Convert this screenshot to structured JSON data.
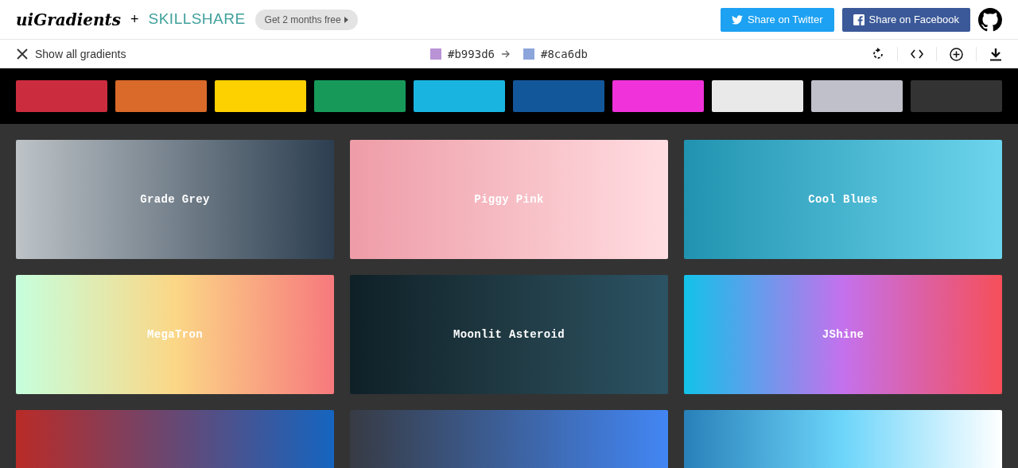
{
  "header": {
    "logo": "uiGradients",
    "plus": "+",
    "partner": "SKILLSHARE",
    "promo": "Get 2 months free",
    "buttons": [
      {
        "kind": "twitter",
        "label": "Share on Twitter"
      },
      {
        "kind": "facebook",
        "label": "Share on Facebook"
      }
    ]
  },
  "toolbar": {
    "back": "Show all gradients",
    "from": {
      "color": "#b993d6",
      "label": "#b993d6"
    },
    "to": {
      "color": "#8ca6db",
      "label": "#8ca6db"
    }
  },
  "swatches": [
    {
      "color": "#cb2d3e"
    },
    {
      "color": "#da6a29"
    },
    {
      "color": "#fdd000"
    },
    {
      "color": "#17995a"
    },
    {
      "color": "#1ab4e1"
    },
    {
      "color": "#13579b"
    },
    {
      "color": "#ef32d9"
    },
    {
      "color": "#e9e9e9"
    },
    {
      "color": "#bfc0c9"
    },
    {
      "color": "#333333"
    }
  ],
  "gradients": [
    {
      "name": "Grade Grey",
      "stops": [
        {
          "color": "#bdc3c7"
        },
        {
          "color": "#2c3e50"
        }
      ]
    },
    {
      "name": "Piggy Pink",
      "stops": [
        {
          "color": "#ee9ca7"
        },
        {
          "color": "#ffdde1"
        }
      ]
    },
    {
      "name": "Cool Blues",
      "stops": [
        {
          "color": "#2193b0"
        },
        {
          "color": "#6dd5ed"
        }
      ]
    },
    {
      "name": "MegaTron",
      "stops": [
        {
          "color": "#c6ffdd"
        },
        {
          "color": "#fbd786"
        },
        {
          "color": "#f7797d"
        }
      ]
    },
    {
      "name": "Moonlit Asteroid",
      "stops": [
        {
          "color": "#0f2027"
        },
        {
          "color": "#203a43"
        },
        {
          "color": "#2c5364"
        }
      ]
    },
    {
      "name": "JShine",
      "stops": [
        {
          "color": "#12c2e9"
        },
        {
          "color": "#c471ed"
        },
        {
          "color": "#f64f59"
        }
      ]
    },
    {
      "stops": [
        {
          "color": "#b92b27"
        },
        {
          "color": "#1565c0"
        }
      ]
    },
    {
      "stops": [
        {
          "color": "#373b44"
        },
        {
          "color": "#4286f4"
        }
      ]
    },
    {
      "stops": [
        {
          "color": "#2980b9"
        },
        {
          "color": "#6dd5fa"
        },
        {
          "color": "#ffffff"
        }
      ]
    }
  ]
}
